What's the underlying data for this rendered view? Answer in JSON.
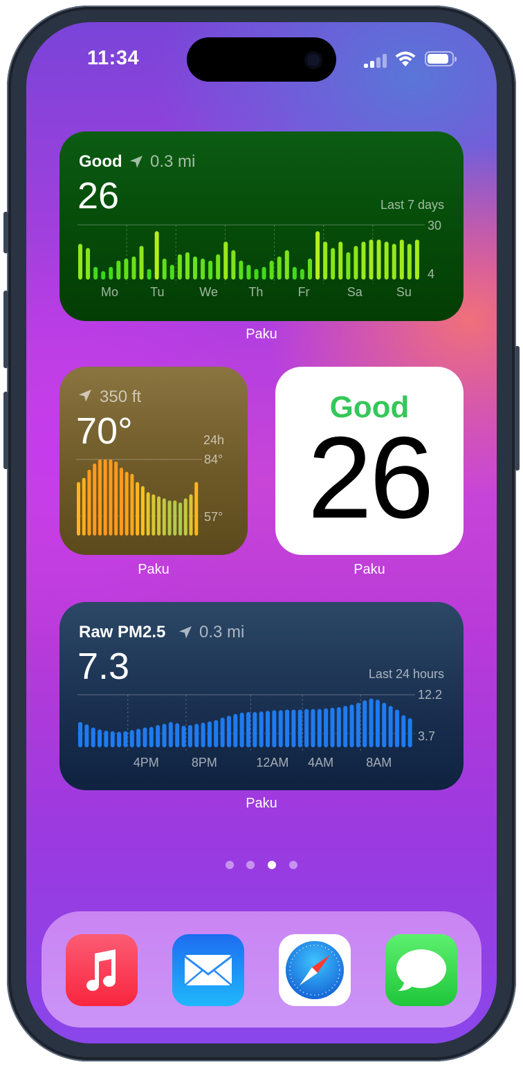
{
  "status_bar": {
    "time": "11:34"
  },
  "aqi_widget": {
    "status": "Good",
    "distance": "0.3 mi",
    "value": "26",
    "range_label": "Last 7 days",
    "y_max": "30",
    "y_min": "4",
    "days": [
      "Mo",
      "Tu",
      "We",
      "Th",
      "Fr",
      "Sa",
      "Su"
    ],
    "caption": "Paku"
  },
  "temp_widget": {
    "elevation": "350 ft",
    "temperature": "70°",
    "range_label": "24h",
    "high": "84°",
    "low": "57°",
    "caption": "Paku"
  },
  "big_aqi_widget": {
    "status": "Good",
    "value": "26",
    "caption": "Paku",
    "status_color": "#34c759"
  },
  "pm_widget": {
    "title": "Raw PM2.5",
    "distance": "0.3 mi",
    "value": "7.3",
    "range_label": "Last 24 hours",
    "y_max": "12.2",
    "y_min": "3.7",
    "times": [
      "4PM",
      "8PM",
      "12AM",
      "4AM",
      "8AM"
    ],
    "caption": "Paku"
  },
  "page_indicator": {
    "count": 4,
    "active": 3
  },
  "dock": {
    "apps": [
      {
        "name": "Music",
        "icon": "music-note-icon",
        "color": "#fa3c52"
      },
      {
        "name": "Mail",
        "icon": "envelope-icon",
        "color": "#1f8bf5"
      },
      {
        "name": "Safari",
        "icon": "compass-icon",
        "color": "#ffffff"
      },
      {
        "name": "Messages",
        "icon": "speech-bubble-icon",
        "color": "#34c759"
      }
    ]
  },
  "chart_data": [
    {
      "type": "bar",
      "title": "Last 7 days",
      "categories": [
        "Mo",
        "Tu",
        "We",
        "Th",
        "Fr",
        "Sa",
        "Su"
      ],
      "ylim": [
        4,
        30
      ],
      "series": [
        {
          "values": [
            21,
            19,
            10,
            8,
            10,
            13,
            14,
            15,
            20,
            9,
            27,
            14,
            11,
            16,
            17,
            15,
            14,
            13,
            16,
            22,
            18,
            13,
            11,
            9,
            10,
            13,
            15,
            18,
            10,
            9,
            14,
            27,
            22,
            19,
            22,
            17,
            20,
            22,
            23,
            23,
            22,
            21,
            23,
            21,
            23
          ]
        }
      ]
    },
    {
      "type": "bar",
      "title": "24h",
      "ylim": [
        57,
        84
      ],
      "series": [
        {
          "values": [
            73,
            75,
            79,
            82,
            84,
            84,
            84,
            83,
            80,
            78,
            77,
            73,
            71,
            68,
            67,
            66,
            65,
            64,
            64,
            63,
            65,
            67,
            73
          ]
        }
      ]
    },
    {
      "type": "bar",
      "title": "Last 24 hours",
      "categories": [
        "4PM",
        "8PM",
        "12AM",
        "4AM",
        "8AM"
      ],
      "ylim": [
        3.7,
        12.2
      ],
      "series": [
        {
          "values": [
            7.8,
            7.4,
            6.9,
            6.6,
            6.4,
            6.3,
            6.2,
            6.3,
            6.5,
            6.7,
            6.9,
            7.0,
            7.3,
            7.5,
            7.8,
            7.6,
            7.2,
            7.3,
            7.5,
            7.7,
            7.9,
            8.1,
            8.5,
            8.8,
            9.1,
            9.3,
            9.4,
            9.4,
            9.5,
            9.6,
            9.7,
            9.7,
            9.8,
            9.8,
            9.8,
            9.9,
            9.9,
            9.9,
            10.0,
            10.1,
            10.2,
            10.4,
            10.6,
            10.9,
            11.3,
            11.6,
            11.4,
            10.9,
            10.4,
            9.8,
            8.9,
            8.4
          ]
        }
      ]
    }
  ]
}
